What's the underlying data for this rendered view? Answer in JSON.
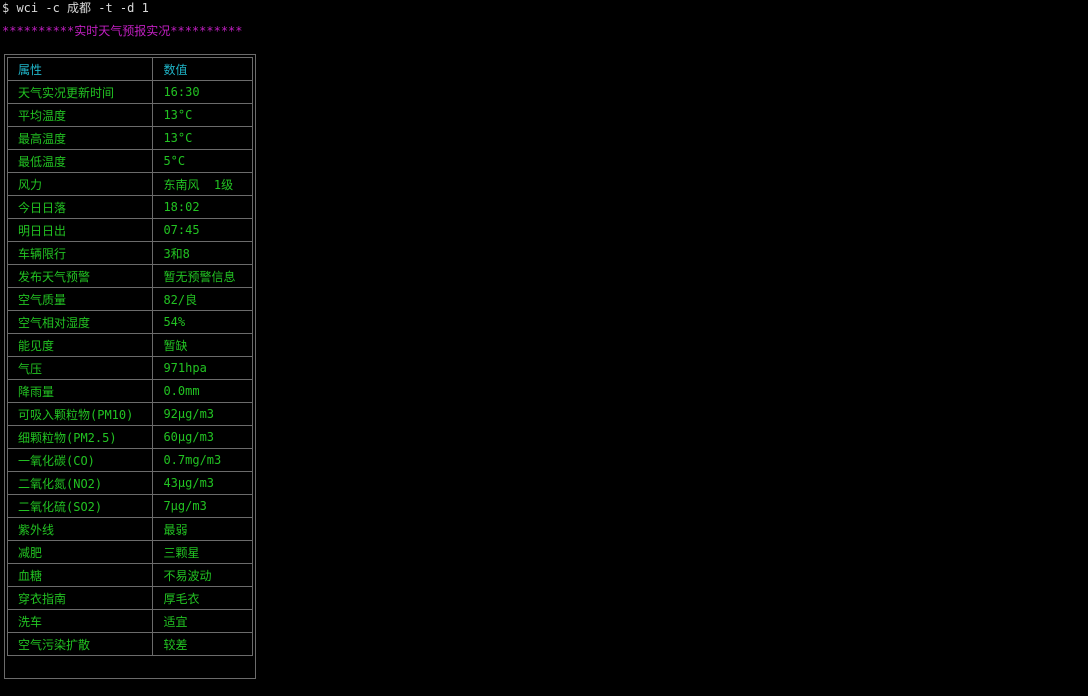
{
  "terminal": {
    "command": "$ wci -c 成都 -t -d 1",
    "banner": "**********实时天气预报实况**********"
  },
  "table": {
    "headers": [
      "属性",
      "数值"
    ],
    "rows": [
      [
        "天气实况更新时间",
        "16:30"
      ],
      [
        "平均温度",
        "13°C"
      ],
      [
        "最高温度",
        "13°C"
      ],
      [
        "最低温度",
        "5°C"
      ],
      [
        "风力",
        "东南风  1级"
      ],
      [
        "今日日落",
        "18:02"
      ],
      [
        "明日日出",
        "07:45"
      ],
      [
        "车辆限行",
        "3和8"
      ],
      [
        "发布天气预警",
        "暂无预警信息"
      ],
      [
        "空气质量",
        "82/良"
      ],
      [
        "空气相对湿度",
        "54%"
      ],
      [
        "能见度",
        "暂缺"
      ],
      [
        "气压",
        "971hpa"
      ],
      [
        "降雨量",
        "0.0mm"
      ],
      [
        "可吸入颗粒物(PM10)",
        "92μg/m3"
      ],
      [
        "细颗粒物(PM2.5)",
        "60μg/m3"
      ],
      [
        "一氧化碳(CO)",
        "0.7mg/m3"
      ],
      [
        "二氧化氮(NO2)",
        "43μg/m3"
      ],
      [
        "二氧化硫(SO2)",
        "7μg/m3"
      ],
      [
        "紫外线",
        "最弱"
      ],
      [
        "减肥",
        "三颗星"
      ],
      [
        "血糖",
        "不易波动"
      ],
      [
        "穿衣指南",
        "厚毛衣"
      ],
      [
        "洗车",
        "适宜"
      ],
      [
        "空气污染扩散",
        "较差"
      ]
    ]
  },
  "colors": {
    "background": "#000000",
    "command_text": "#d8d8d8",
    "banner_text": "#c21fc2",
    "header_text": "#1fb5c8",
    "row_text": "#22c222",
    "border": "#6b6b6b"
  }
}
